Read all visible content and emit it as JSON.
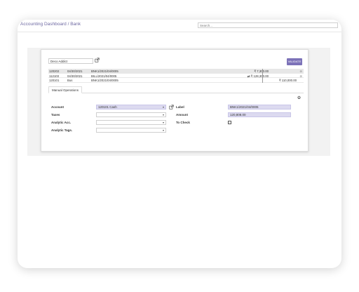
{
  "header": {
    "breadcrumb_parent": "Accounting Dashboard",
    "breadcrumb_sep": " / ",
    "breadcrumb_current": "Bank",
    "search_placeholder": "Search..."
  },
  "reconcile": {
    "partner": "Deco Addict",
    "validate_label": "VALIDATE",
    "lines": [
      {
        "id": "120202",
        "date": "04/30/2021",
        "ref": "BNK1/2021/04/0005",
        "amount": "₹ 7,300.00",
        "balance": "",
        "action": "⊗"
      },
      {
        "id": "112103",
        "date": "04/30/2021",
        "ref": "BILL/2021/04/0005",
        "amount": "⇄ ₹ 128,300.00",
        "balance": "",
        "action": "⊗"
      },
      {
        "id": "120101",
        "date": "Bus",
        "ref": "BNK1/2021/04/0005",
        "amount": "",
        "balance": "₹ 110,000.00",
        "action": ""
      }
    ],
    "tab_label": "Manual Operations",
    "gear_glyph": "✿",
    "form": {
      "account_label": "Account",
      "account_value": "120101 Cash",
      "taxes_label": "Taxes",
      "analytic_acc_label": "Analytic Acc.",
      "analytic_tags_label": "Analytic Tags.",
      "label_label": "Label",
      "label_value": "BNK1/2021/04/0005",
      "amount_label": "Amount",
      "amount_value": "120,808.00",
      "to_check_label": "To Check"
    }
  }
}
